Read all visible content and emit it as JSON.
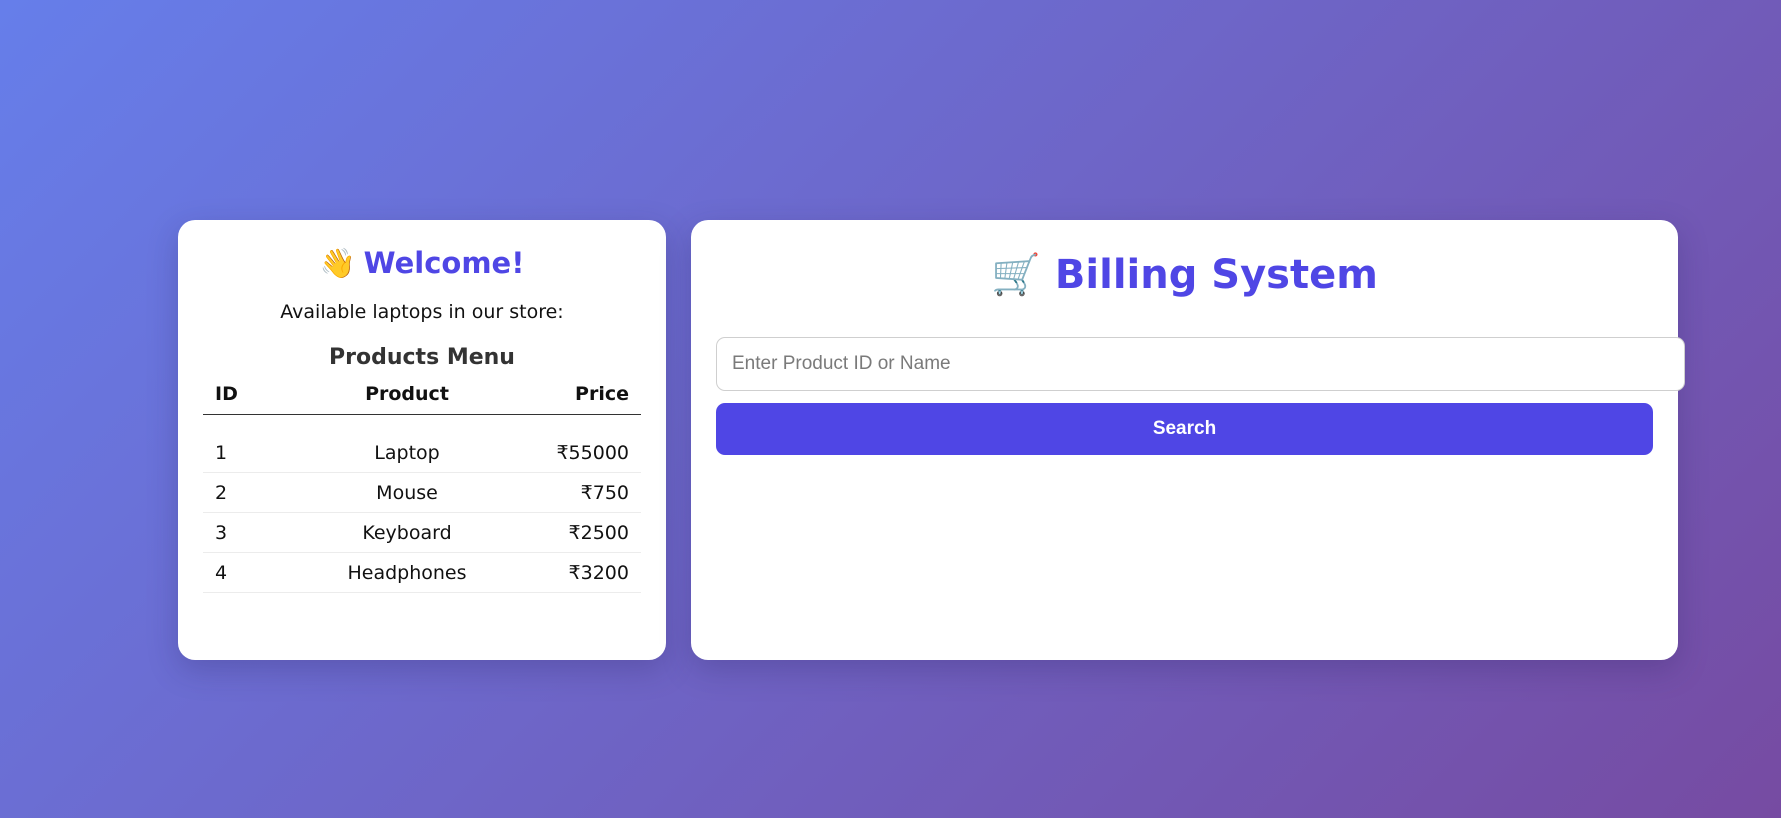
{
  "welcome": {
    "icon": "waving-hand-icon",
    "emoji": "👋",
    "title": "Welcome!",
    "intro": "Available laptops in our store:",
    "menu_title": "Products Menu",
    "columns": [
      "ID",
      "Product",
      "Price"
    ],
    "products": [
      {
        "id": "1",
        "name": "Laptop",
        "price": "₹55000"
      },
      {
        "id": "2",
        "name": "Mouse",
        "price": "₹750"
      },
      {
        "id": "3",
        "name": "Keyboard",
        "price": "₹2500"
      },
      {
        "id": "4",
        "name": "Headphones",
        "price": "₹3200"
      }
    ]
  },
  "billing": {
    "icon": "shopping-cart-icon",
    "emoji": "🛒",
    "title": "Billing System",
    "search_placeholder": "Enter Product ID or Name",
    "search_value": "",
    "search_button": "Search"
  },
  "colors": {
    "accent": "#4f46e5",
    "background_start": "#667eea",
    "background_end": "#764ba2"
  }
}
